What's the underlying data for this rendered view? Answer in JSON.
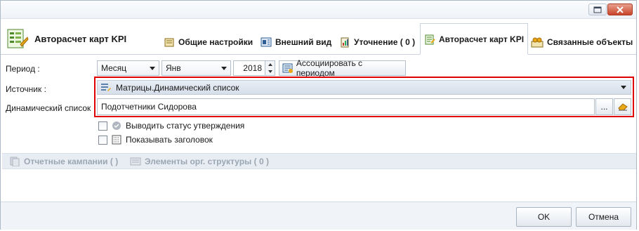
{
  "window": {
    "restore_icon": "restore-icon",
    "close_icon": "close-icon"
  },
  "header": {
    "title": "Авторасчет карт KPI",
    "tabs": [
      {
        "label": "Общие настройки",
        "icon": "settings-icon"
      },
      {
        "label": "Внешний вид",
        "icon": "appearance-icon"
      },
      {
        "label": "Уточнение ( 0 )",
        "icon": "refine-icon"
      },
      {
        "label": "Авторасчет карт KPI",
        "icon": "kpi-icon",
        "active": true
      },
      {
        "label": "Связанные объекты",
        "icon": "linked-objects-icon"
      }
    ]
  },
  "form": {
    "period_label": "Период :",
    "period_type": "Месяц",
    "period_month": "Янв",
    "period_year": "2018",
    "associate_label": "Ассоциировать с периодом",
    "source_label": "Источник :",
    "source_value": "Матрицы.Динамический список",
    "dynlist_label": "Динамический список",
    "dynlist_value": "Подотчетники Сидорова",
    "browse_label": "...",
    "show_status_label": "Выводить статус утверждения",
    "show_header_label": "Показывать заголовок"
  },
  "subtabs": [
    {
      "label": "Отчетные кампании ( )"
    },
    {
      "label": "Элементы орг. структуры ( 0 )"
    }
  ],
  "footer": {
    "ok_label": "OK",
    "cancel_label": "Отмена"
  },
  "colors": {
    "highlight": "#e00000",
    "accent": "#3a6ea5"
  }
}
